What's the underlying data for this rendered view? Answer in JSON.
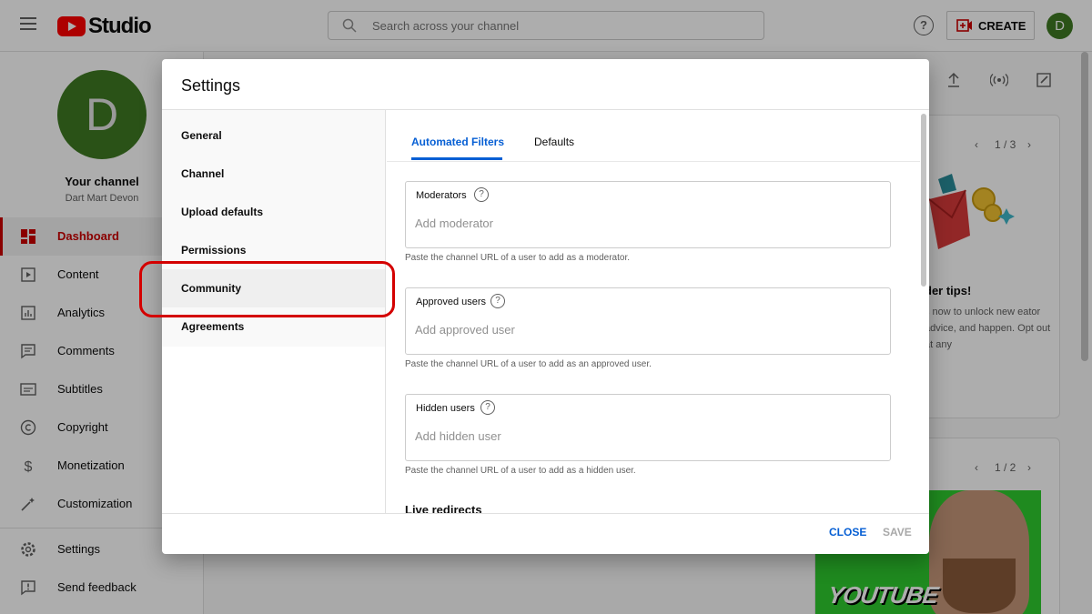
{
  "topbar": {
    "logo_text": "Studio",
    "search_placeholder": "Search across your channel",
    "help_glyph": "?",
    "create_label": "CREATE",
    "avatar_initial": "D"
  },
  "sidebar": {
    "avatar_initial": "D",
    "your_channel": "Your channel",
    "channel_name": "Dart Mart Devon",
    "items": [
      {
        "label": "Dashboard",
        "icon": "dashboard-icon",
        "active": true
      },
      {
        "label": "Content",
        "icon": "content-icon"
      },
      {
        "label": "Analytics",
        "icon": "analytics-icon"
      },
      {
        "label": "Comments",
        "icon": "comments-icon"
      },
      {
        "label": "Subtitles",
        "icon": "subtitles-icon"
      },
      {
        "label": "Copyright",
        "icon": "copyright-icon"
      },
      {
        "label": "Monetization",
        "icon": "monetization-icon"
      },
      {
        "label": "Customization",
        "icon": "customization-icon"
      },
      {
        "label": "Settings",
        "icon": "settings-icon"
      },
      {
        "label": "Send feedback",
        "icon": "feedback-icon"
      }
    ]
  },
  "background_cards": {
    "card1_pager": "1 / 3",
    "tips_title": "der tips!",
    "tips_body": "s now to unlock new eator advice, and happen. Opt out at any",
    "card2_pager": "1 / 2",
    "thumb_text": "YOUTUBE"
  },
  "dialog": {
    "title": "Settings",
    "nav": [
      {
        "label": "General"
      },
      {
        "label": "Channel"
      },
      {
        "label": "Upload defaults"
      },
      {
        "label": "Permissions"
      },
      {
        "label": "Community",
        "selected": true
      },
      {
        "label": "Agreements"
      }
    ],
    "tabs": [
      {
        "label": "Automated Filters",
        "active": true
      },
      {
        "label": "Defaults"
      }
    ],
    "fields": [
      {
        "label": "Moderators",
        "placeholder": "Add moderator",
        "hint": "Paste the channel URL of a user to add as a moderator."
      },
      {
        "label": "Approved users",
        "placeholder": "Add approved user",
        "hint": "Paste the channel URL of a user to add as an approved user."
      },
      {
        "label": "Hidden users",
        "placeholder": "Add hidden user",
        "hint": "Paste the channel URL of a user to add as a hidden user."
      }
    ],
    "next_section": "Live redirects",
    "close_label": "CLOSE",
    "save_label": "SAVE"
  },
  "colors": {
    "accent_blue": "#065fd4",
    "brand_red": "#ff0000",
    "active_red": "#cc0000",
    "highlight_ring": "#d40000",
    "avatar_green": "#3e7a22"
  }
}
